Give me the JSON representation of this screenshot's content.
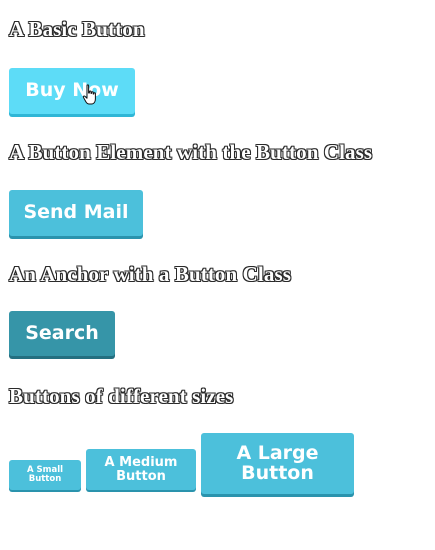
{
  "sections": {
    "basic": {
      "heading": "A Basic Button",
      "button_label": "Buy Now"
    },
    "element": {
      "heading": "A Button Element with the Button Class",
      "button_label": "Send Mail"
    },
    "anchor": {
      "heading": "An Anchor with a Button Class",
      "button_label": "Search"
    },
    "sizes": {
      "heading": "Buttons of different sizes",
      "small_label": "A Small Button",
      "medium_label": "A Medium Button",
      "large_label": "A Large Button"
    }
  },
  "colors": {
    "button": "#4cc0db",
    "button_hover": "#5ddcf7",
    "button_active": "#3695a8"
  },
  "icons": {
    "cursor": "hand-pointer-icon"
  }
}
